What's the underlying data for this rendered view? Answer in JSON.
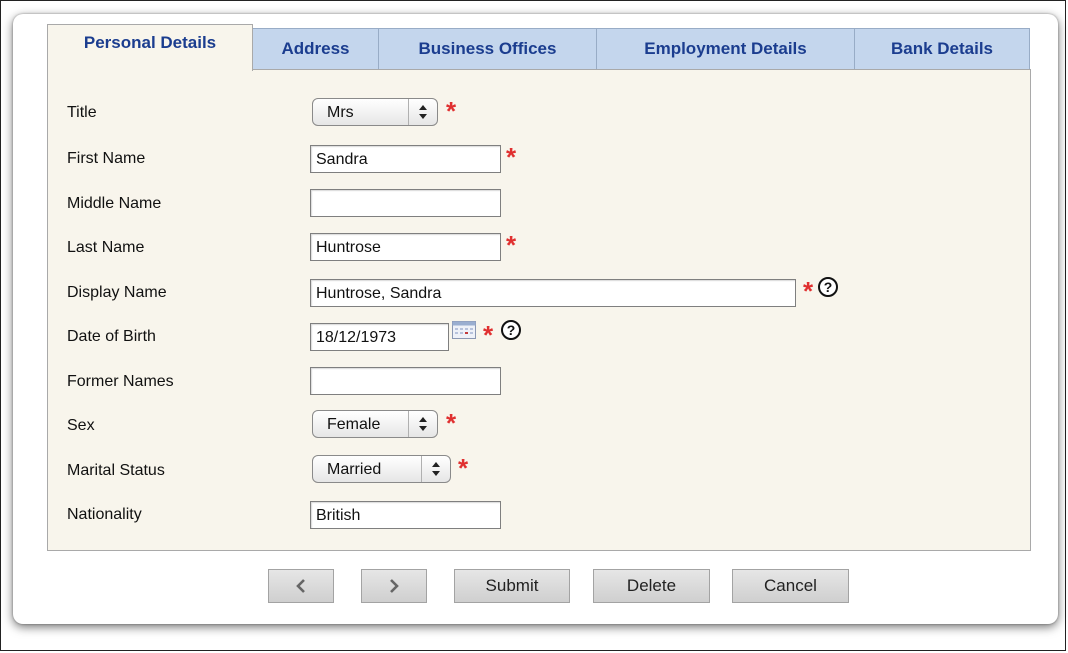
{
  "tabs": [
    {
      "label": "Personal Details",
      "active": true
    },
    {
      "label": "Address",
      "active": false
    },
    {
      "label": "Business Offices",
      "active": false
    },
    {
      "label": "Employment Details",
      "active": false
    },
    {
      "label": "Bank Details",
      "active": false
    }
  ],
  "form": {
    "title": {
      "label": "Title",
      "value": "Mrs",
      "required": true
    },
    "first_name": {
      "label": "First Name",
      "value": "Sandra",
      "required": true
    },
    "middle_name": {
      "label": "Middle Name",
      "value": ""
    },
    "last_name": {
      "label": "Last Name",
      "value": "Huntrose",
      "required": true
    },
    "display_name": {
      "label": "Display Name",
      "value": "Huntrose, Sandra",
      "required": true,
      "help": "?"
    },
    "date_of_birth": {
      "label": "Date of Birth",
      "value": "18/12/1973",
      "required": true,
      "help": "?"
    },
    "former_names": {
      "label": "Former Names",
      "value": ""
    },
    "sex": {
      "label": "Sex",
      "value": "Female",
      "required": true
    },
    "marital_status": {
      "label": "Marital Status",
      "value": "Married",
      "required": true
    },
    "nationality": {
      "label": "Nationality",
      "value": "British"
    }
  },
  "required_marker": "*",
  "buttons": {
    "prev": "‹",
    "next": "›",
    "submit": "Submit",
    "delete": "Delete",
    "cancel": "Cancel"
  },
  "colors": {
    "tab_text": "#1b3d8f",
    "tab_inactive_bg": "#c4d6ed",
    "panel_bg": "#f8f5ec",
    "required": "#e03030"
  },
  "icons": {
    "select_arrow": "up-down-chevron-icon",
    "calendar": "calendar-icon",
    "help": "help-icon"
  }
}
